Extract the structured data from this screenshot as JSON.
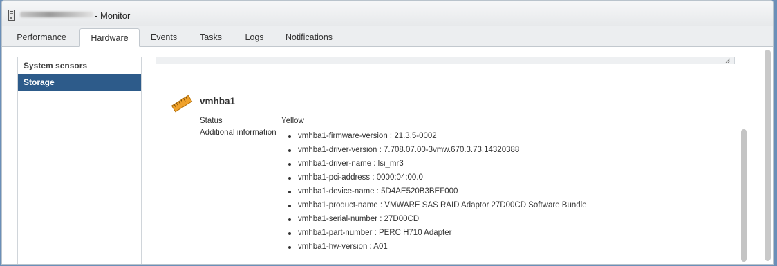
{
  "window": {
    "title": "- Monitor"
  },
  "tabs": [
    {
      "label": "Performance",
      "active": false
    },
    {
      "label": "Hardware",
      "active": true
    },
    {
      "label": "Events",
      "active": false
    },
    {
      "label": "Tasks",
      "active": false
    },
    {
      "label": "Logs",
      "active": false
    },
    {
      "label": "Notifications",
      "active": false
    }
  ],
  "sidebar": {
    "items": [
      {
        "label": "System sensors",
        "active": false
      },
      {
        "label": "Storage",
        "active": true
      }
    ]
  },
  "device": {
    "name": "vmhba1",
    "icon": "storage-adapter-icon",
    "status_label": "Status",
    "status_value": "Yellow",
    "additional_label": "Additional information",
    "info": [
      "vmhba1-firmware-version : 21.3.5-0002",
      "vmhba1-driver-version : 7.708.07.00-3vmw.670.3.73.14320388",
      "vmhba1-driver-name : lsi_mr3",
      "vmhba1-pci-address : 0000:04:00.0",
      "vmhba1-device-name : 5D4AE520B3BEF000",
      "vmhba1-product-name : VMWARE SAS RAID Adaptor 27D00CD Software Bundle",
      "vmhba1-serial-number : 27D00CD",
      "vmhba1-part-number : PERC H710 Adapter",
      "vmhba1-hw-version : A01"
    ]
  },
  "colors": {
    "accent": "#2d5b8a",
    "icon_orange": "#f0a22b"
  }
}
